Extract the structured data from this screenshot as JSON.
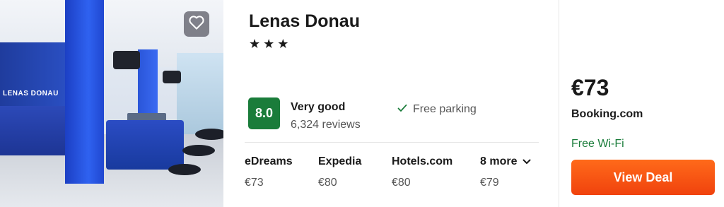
{
  "hotel": {
    "name": "Lenas Donau",
    "stars": "★★★",
    "photo_sign": "LENAS DONAU"
  },
  "favorite": {
    "icon": "heart-icon"
  },
  "rating": {
    "score": "8.0",
    "label": "Very good",
    "reviews": "6,324 reviews",
    "color": "#1a7c3a"
  },
  "amenity": {
    "label": "Free parking",
    "icon": "check-icon"
  },
  "providers": [
    {
      "name": "eDreams",
      "price": "€73"
    },
    {
      "name": "Expedia",
      "price": "€80"
    },
    {
      "name": "Hotels.com",
      "price": "€80"
    },
    {
      "name": "8 more",
      "price": "€79",
      "icon": "chevron-down-icon"
    }
  ],
  "deal": {
    "price": "€73",
    "site": "Booking.com",
    "perk": "Free Wi-Fi",
    "button": "View Deal",
    "button_color": "#f0420d",
    "perk_color": "#1a7c3a"
  }
}
